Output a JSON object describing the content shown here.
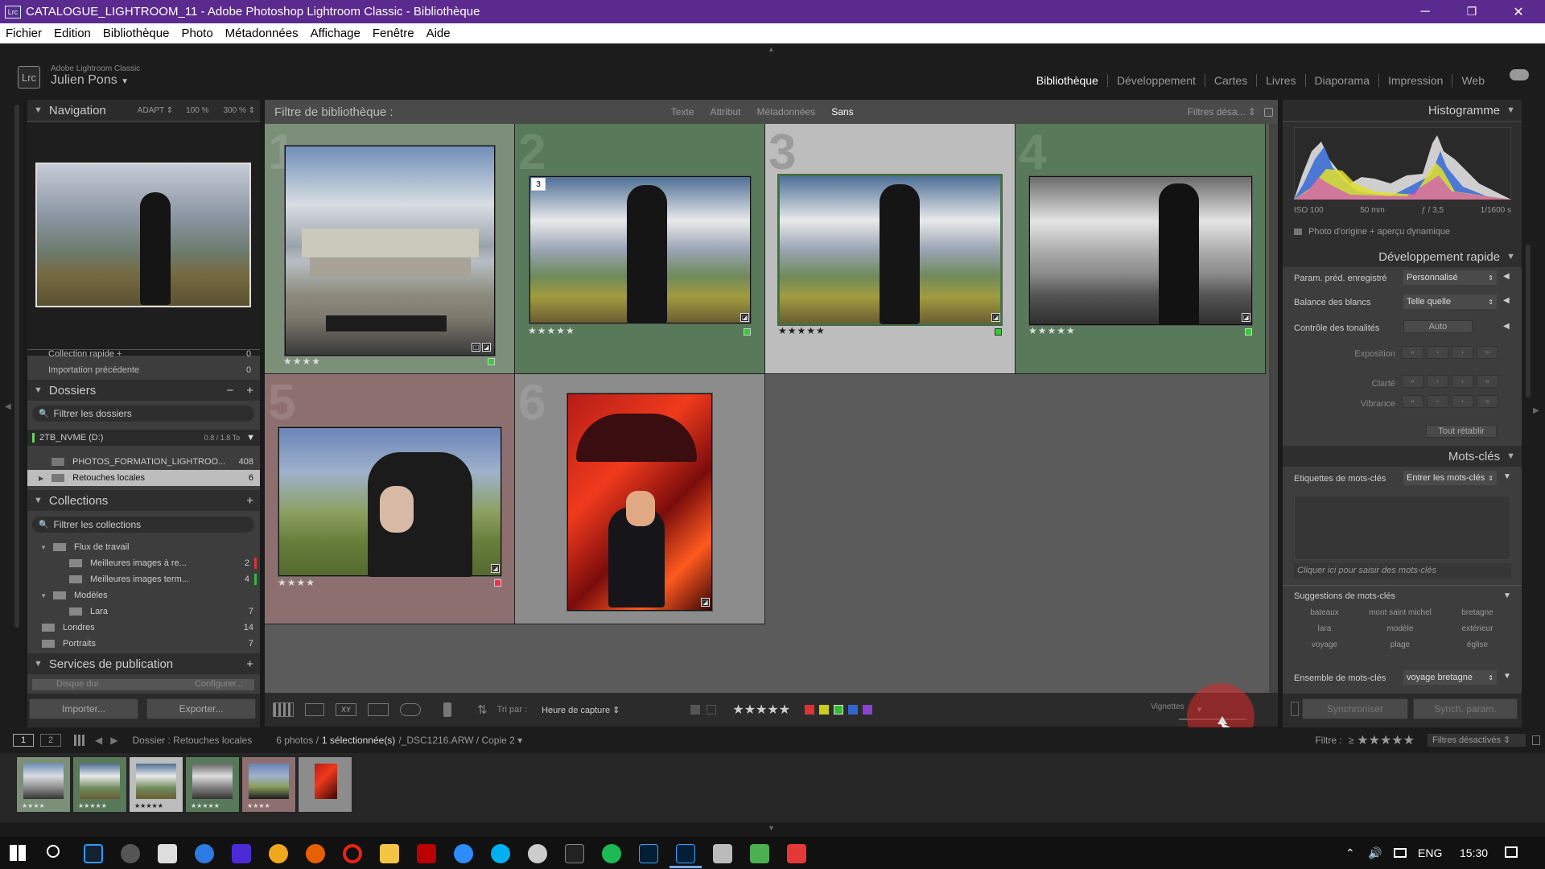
{
  "window": {
    "title": "CATALOGUE_LIGHTROOM_11 - Adobe Photoshop Lightroom Classic - Bibliothèque",
    "minimize": "─",
    "restore": "❐",
    "close": "✕"
  },
  "menu": [
    "Fichier",
    "Edition",
    "Bibliothèque",
    "Photo",
    "Métadonnées",
    "Affichage",
    "Fenêtre",
    "Aide"
  ],
  "identity": {
    "product": "Adobe Lightroom Classic",
    "user": "Julien Pons",
    "logo": "Lrc"
  },
  "modules": [
    "Bibliothèque",
    "Développement",
    "Cartes",
    "Livres",
    "Diaporama",
    "Impression",
    "Web"
  ],
  "navigation": {
    "title": "Navigation",
    "fit": "ADAPT ⇕",
    "zoom1": "100 %",
    "zoom2": "300 % ⇕"
  },
  "catalog_rows": [
    {
      "label": "Collection rapide +",
      "count": "0"
    },
    {
      "label": "Importation précédente",
      "count": "0"
    }
  ],
  "folders": {
    "title": "Dossiers",
    "filter": "Filtrer les dossiers",
    "drive": "2TB_NVME (D:)",
    "drive_size": "0.8 / 1.8 To",
    "items": [
      {
        "label": "PHOTOS_FORMATION_LIGHTROO...",
        "count": "408"
      },
      {
        "label": "Retouches locales",
        "count": "6"
      }
    ]
  },
  "collections": {
    "title": "Collections",
    "filter": "Filtrer les collections",
    "items": [
      {
        "label": "Flux de travail",
        "count": ""
      },
      {
        "label": "Meilleures images à re...",
        "count": "2"
      },
      {
        "label": "Meilleures images term...",
        "count": "4"
      },
      {
        "label": "Modèles",
        "count": ""
      },
      {
        "label": "Lara",
        "count": "7"
      },
      {
        "label": "Londres",
        "count": "14"
      },
      {
        "label": "Portraits",
        "count": "7"
      }
    ]
  },
  "publish": {
    "title": "Services de publication",
    "disk": "Disque dur",
    "configure": "Configurer..."
  },
  "buttons": {
    "import": "Importer...",
    "export": "Exporter...",
    "sync": "Synchroniser",
    "sync_params": "Synch. param."
  },
  "filter_bar": {
    "title": "Filtre de bibliothèque :",
    "tabs": [
      "Texte",
      "Attribut",
      "Métadonnées",
      "Sans"
    ],
    "preset": "Filtres désa... ⇕"
  },
  "grid": [
    {
      "num": "1",
      "stars": "★★★★"
    },
    {
      "num": "2",
      "stars": "★★★★★",
      "stack": "3"
    },
    {
      "num": "3",
      "stars": "★★★★★"
    },
    {
      "num": "4",
      "stars": "★★★★★"
    },
    {
      "num": "5",
      "stars": "★★★★"
    },
    {
      "num": "6",
      "stars": ""
    }
  ],
  "toolbar": {
    "sort_label": "Tri par :",
    "sort_value": "Heure de capture",
    "stars": "★★★★★",
    "thumb_label": "Vignettes"
  },
  "histogram": {
    "title": "Histogramme",
    "iso": "ISO 100",
    "focal": "50 mm",
    "aperture": "ƒ / 3,5",
    "shutter": "1/1600 s",
    "preview": "Photo d'origine + aperçu dynamique"
  },
  "quick_develop": {
    "title": "Développement rapide",
    "preset_label": "Param. préd. enregistré",
    "preset_value": "Personnalisé",
    "wb_label": "Balance des blancs",
    "wb_value": "Telle quelle",
    "tone_label": "Contrôle des tonalités",
    "auto": "Auto",
    "exposure": "Exposition",
    "clarity": "Clarté",
    "vibrance": "Vibrance",
    "reset": "Tout rétablir"
  },
  "keywords": {
    "title": "Mots-clés",
    "tags_label": "Etiquettes de mots-clés",
    "tags_value": "Entrer les mots-clés",
    "click_hint": "Cliquer ici pour saisir des mots-clés",
    "suggestions_title": "Suggestions de mots-clés",
    "suggestions": [
      "bateaux",
      "mont saint michel",
      "bretagne",
      "lara",
      "modèle",
      "extérieur",
      "voyage",
      "plage",
      "église"
    ],
    "set_label": "Ensemble de mots-clés",
    "set_value": "voyage bretagne"
  },
  "statusbar": {
    "page1": "1",
    "page2": "2",
    "source": "Dossier : Retouches locales",
    "count": "6 photos /",
    "selected": "1 sélectionnée(s)",
    "file": "/_DSC1216.ARW / Copie 2 ▾",
    "filter": "Filtre :",
    "filter_op": "≥",
    "filter_stars": "★★★★★",
    "filter_state": "Filtres désactivés"
  },
  "filmstrip_stars": [
    "★★★★",
    "★★★★★",
    "★★★★★",
    "★★★★★",
    "★★★★",
    ""
  ],
  "taskbar": {
    "lang": "ENG",
    "time": "15:30"
  }
}
